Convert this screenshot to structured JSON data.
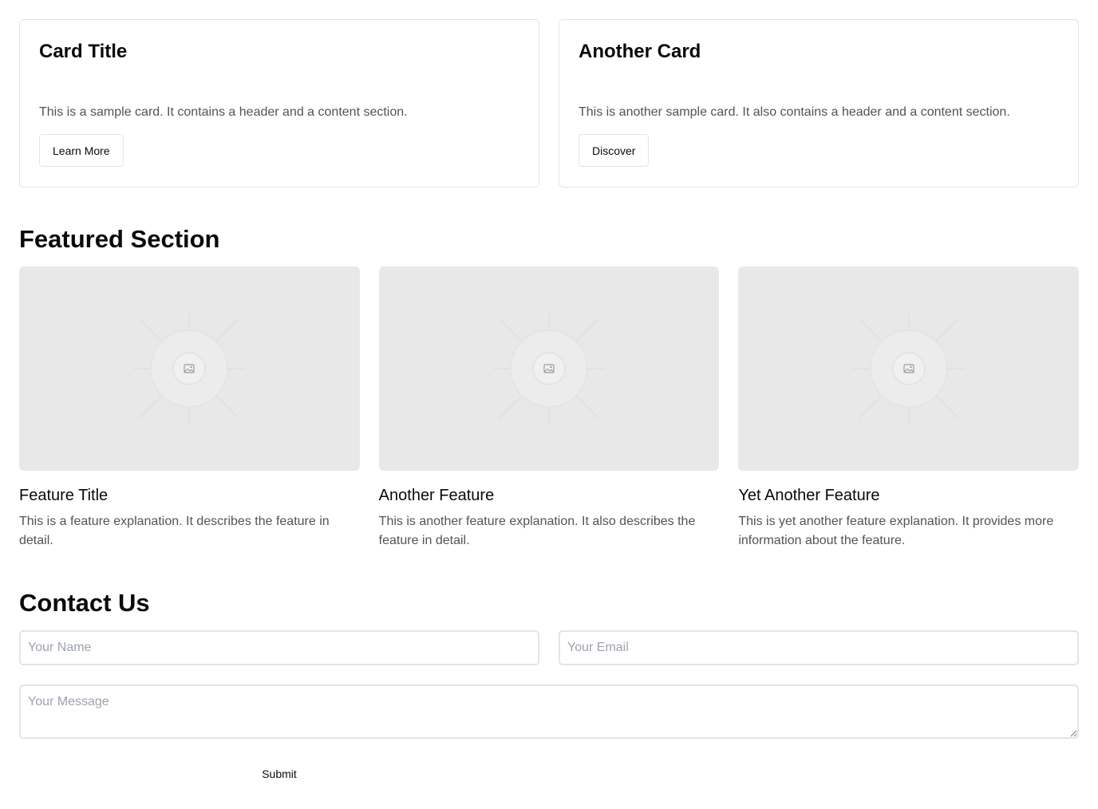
{
  "cards": [
    {
      "title": "Card Title",
      "description": "This is a sample card. It contains a header and a content section.",
      "button_label": "Learn More"
    },
    {
      "title": "Another Card",
      "description": "This is another sample card. It also contains a header and a content section.",
      "button_label": "Discover"
    }
  ],
  "featured": {
    "title": "Featured Section",
    "items": [
      {
        "title": "Feature Title",
        "description": "This is a feature explanation. It describes the feature in detail.",
        "image_icon": "image-placeholder-icon"
      },
      {
        "title": "Another Feature",
        "description": "This is another feature explanation. It also describes the feature in detail.",
        "image_icon": "image-placeholder-icon"
      },
      {
        "title": "Yet Another Feature",
        "description": "This is yet another feature explanation. It provides more information about the feature.",
        "image_icon": "image-placeholder-icon"
      }
    ]
  },
  "contact": {
    "title": "Contact Us",
    "name_placeholder": "Your Name",
    "email_placeholder": "Your Email",
    "message_placeholder": "Your Message",
    "submit_label": "Submit"
  },
  "colors": {
    "border": "#e4e4e7",
    "muted_text": "#52525b",
    "placeholder_bg": "#e8e8e8"
  }
}
